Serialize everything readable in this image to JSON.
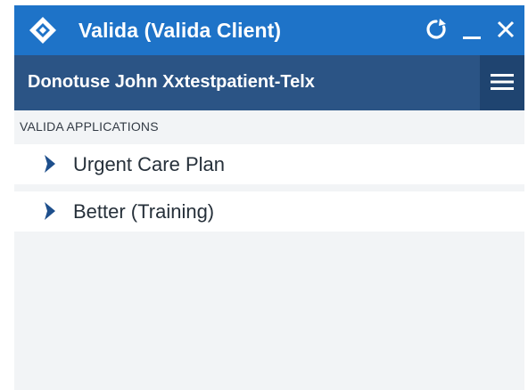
{
  "window": {
    "title": "Valida (Valida Client)",
    "controls": {
      "refresh_icon": "refresh-icon",
      "minimize_icon": "minimize-icon",
      "close_icon": "close-icon"
    }
  },
  "patient": {
    "name": "Donotuse John Xxtestpatient-Telx",
    "menu_icon": "hamburger-menu-icon"
  },
  "applications": {
    "heading": "VALIDA APPLICATIONS",
    "items": [
      {
        "label": "Urgent Care Plan",
        "icon": "chevron-right-icon"
      },
      {
        "label": "Better (Training)",
        "icon": "chevron-right-icon"
      }
    ]
  },
  "colors": {
    "title_bar": "#1e73c8",
    "patient_bar": "#2b5485",
    "menu_button": "#1f4470",
    "chevron": "#1e4f8c"
  }
}
